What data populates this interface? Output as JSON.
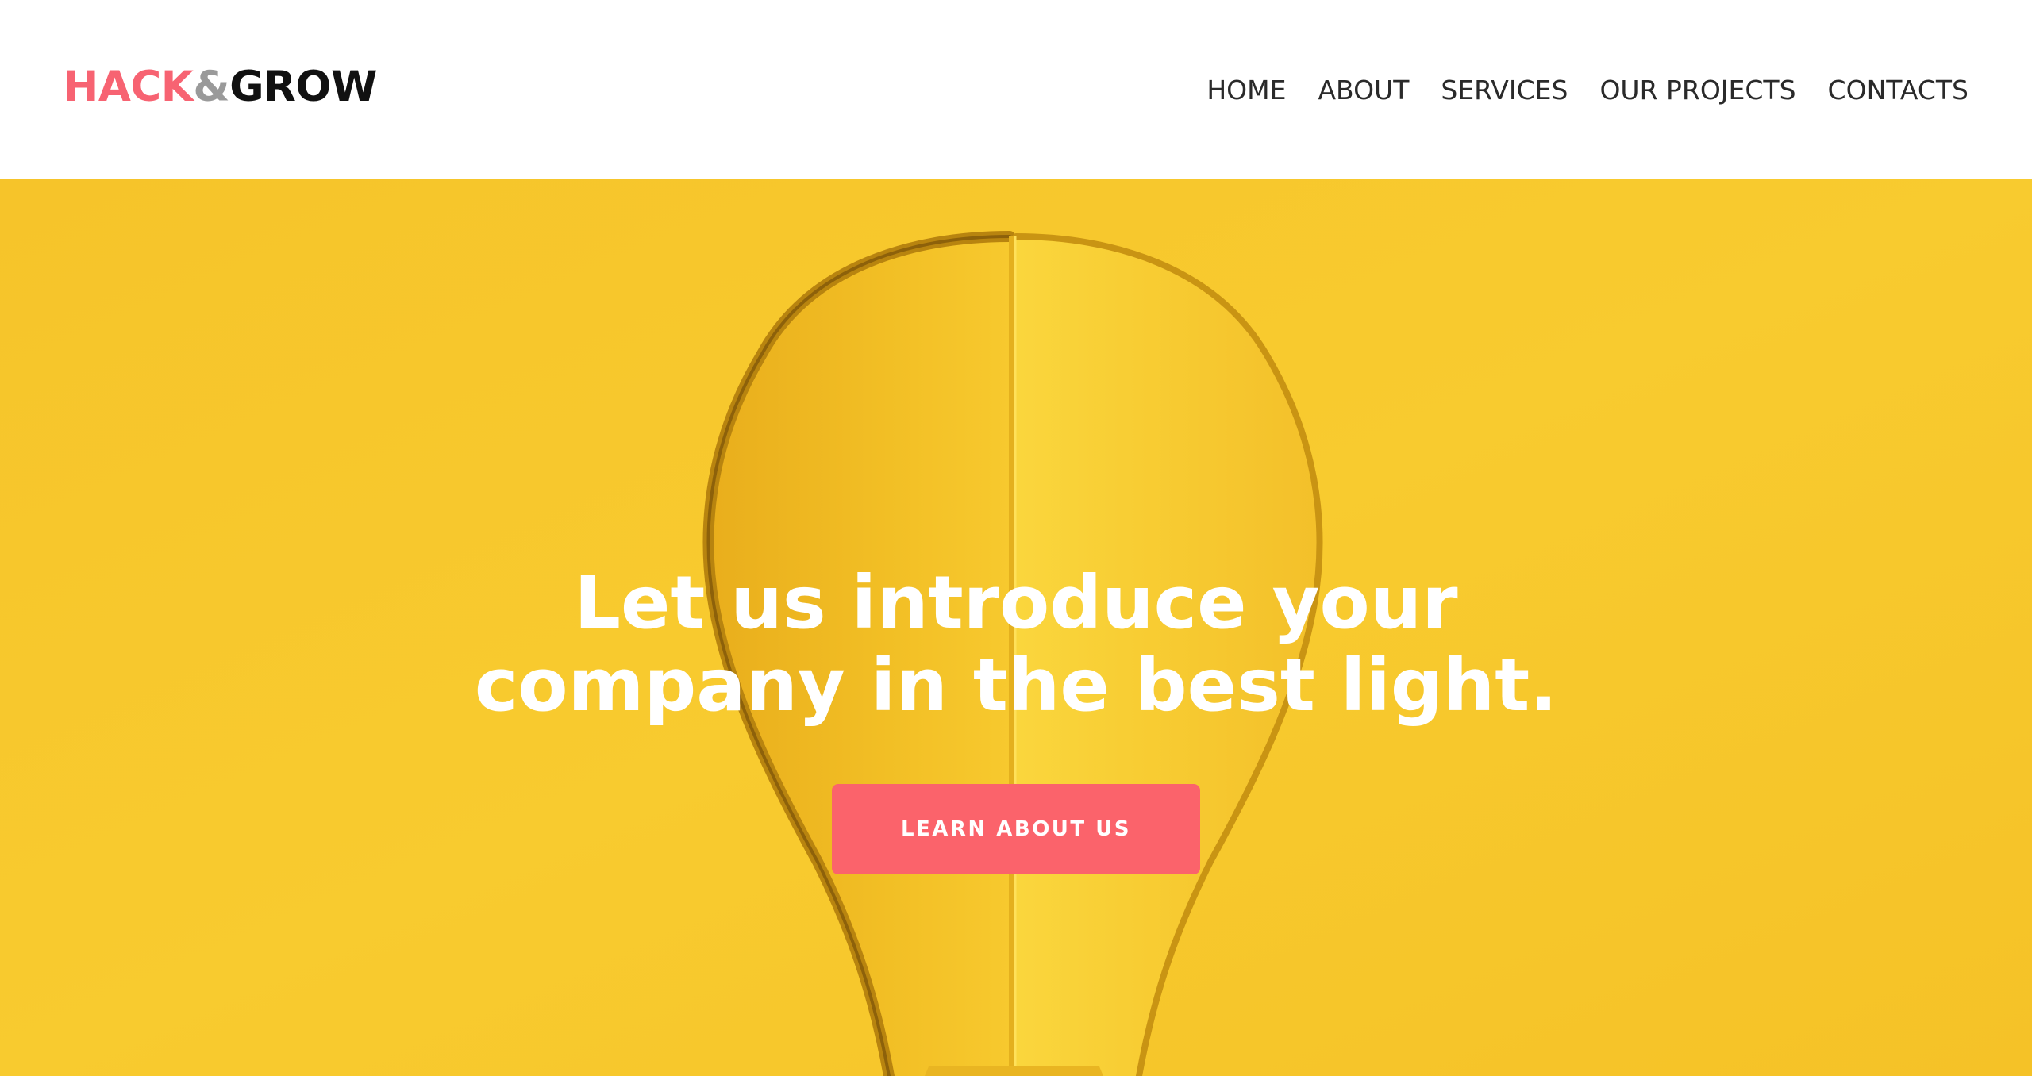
{
  "header": {
    "logo": {
      "part_1": "HACK",
      "ampersand": "&",
      "part_2": "GROW"
    },
    "nav": {
      "items": [
        {
          "label": "HOME"
        },
        {
          "label": "ABOUT"
        },
        {
          "label": "SERVICES"
        },
        {
          "label": "OUR PROJECTS"
        },
        {
          "label": "CONTACTS"
        }
      ]
    }
  },
  "hero": {
    "title_line_1": "Let us introduce your",
    "title_line_2": "company in the best light.",
    "cta_label": "LEARN ABOUT US",
    "image": "lightbulb-paper-cutout-image"
  },
  "colors": {
    "brand_accent": "#f76372",
    "button": "#fb636b",
    "hero_background": "#f8c82c",
    "logo_ampersand": "#9a9a9a",
    "logo_text_dark": "#111111",
    "nav_text": "#2a2a2a"
  }
}
